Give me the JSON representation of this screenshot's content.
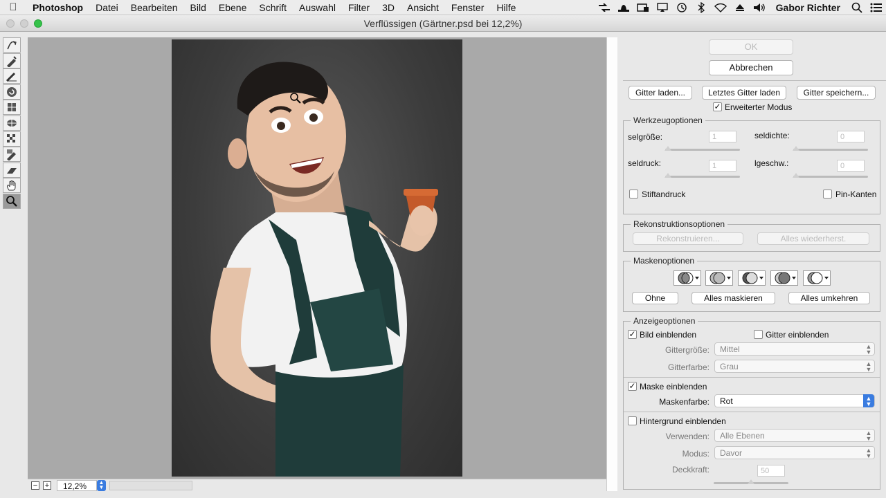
{
  "menubar": {
    "app": "Photoshop",
    "items": [
      "Datei",
      "Bearbeiten",
      "Bild",
      "Ebene",
      "Schrift",
      "Auswahl",
      "Filter",
      "3D",
      "Ansicht",
      "Fenster",
      "Hilfe"
    ],
    "user": "Gabor Richter"
  },
  "window": {
    "title": "Verflüssigen (Gärtner.psd bei 12,2%)"
  },
  "status": {
    "zoom": "12,2%",
    "zoom_minus": "−",
    "zoom_plus": "+"
  },
  "panel": {
    "ok": "OK",
    "cancel": "Abbrechen",
    "load_mesh": "Gitter laden...",
    "load_last_mesh": "Letztes Gitter laden",
    "save_mesh": "Gitter speichern...",
    "advanced_mode": "Erweiterter Modus",
    "advanced_mode_checked": true,
    "tool_options": {
      "title": "Werkzeugoptionen",
      "brush_size_label": "selgröße:",
      "brush_size_value": "1",
      "brush_density_label": "seldichte:",
      "brush_density_value": "0",
      "brush_pressure_label": "seldruck:",
      "brush_pressure_value": "1",
      "brush_rate_label": "lgeschw.:",
      "brush_rate_value": "0",
      "stylus_pressure": "Stiftandruck",
      "pin_edges": "Pin-Kanten"
    },
    "reconstruct_options": {
      "title": "Rekonstruktionsoptionen",
      "reconstruct": "Rekonstruieren...",
      "restore_all": "Alles wiederherst."
    },
    "mask_options": {
      "title": "Maskenoptionen",
      "none": "Ohne",
      "mask_all": "Alles maskieren",
      "invert_all": "Alles umkehren"
    },
    "view_options": {
      "title": "Anzeigeoptionen",
      "show_image": "Bild einblenden",
      "show_image_checked": true,
      "show_mesh": "Gitter einblenden",
      "show_mesh_checked": false,
      "mesh_size_label": "Gittergröße:",
      "mesh_size_value": "Mittel",
      "mesh_color_label": "Gitterfarbe:",
      "mesh_color_value": "Grau",
      "show_mask": "Maske einblenden",
      "show_mask_checked": true,
      "mask_color_label": "Maskenfarbe:",
      "mask_color_value": "Rot",
      "show_backdrop": "Hintergrund einblenden",
      "show_backdrop_checked": false,
      "use_label": "Verwenden:",
      "use_value": "Alle Ebenen",
      "mode_label": "Modus:",
      "mode_value": "Davor",
      "opacity_label": "Deckkraft:",
      "opacity_value": "50"
    }
  },
  "colors": {
    "accent": "#3a7ce0",
    "zoom_green": "#35c24a"
  },
  "icons": {
    "tools": [
      "forward-warp-icon",
      "reconstruct-icon",
      "smooth-icon",
      "twirl-icon",
      "pucker-icon",
      "bloat-icon",
      "push-left-icon",
      "freeze-mask-icon",
      "thaw-mask-icon",
      "hand-icon",
      "zoom-icon"
    ]
  }
}
